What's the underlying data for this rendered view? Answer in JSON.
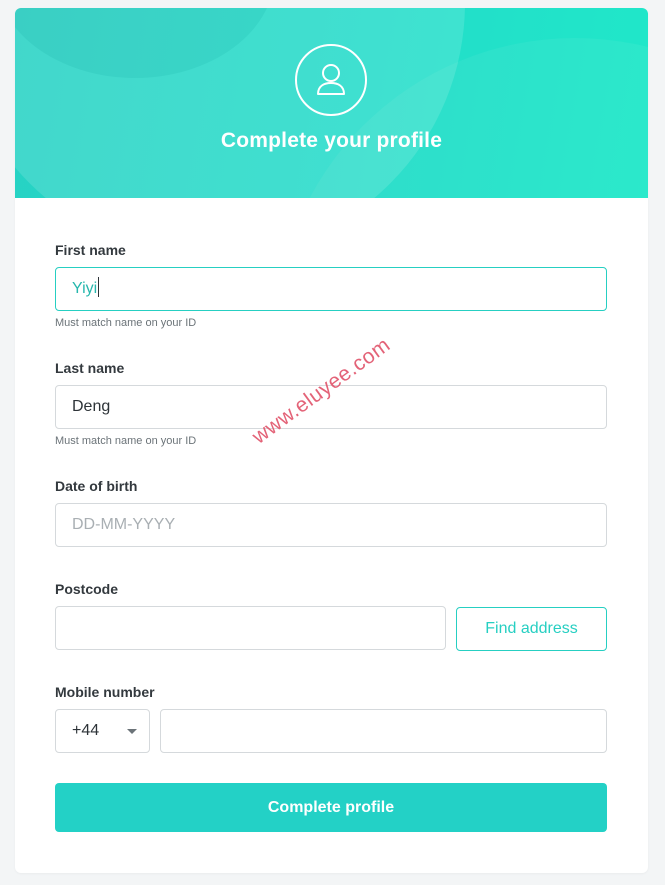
{
  "header": {
    "title": "Complete your profile",
    "icon": "user-icon"
  },
  "form": {
    "first_name": {
      "label": "First name",
      "value": "Yiyi",
      "help": "Must match name on your ID"
    },
    "last_name": {
      "label": "Last name",
      "value": "Deng",
      "help": "Must match name on your ID"
    },
    "dob": {
      "label": "Date of birth",
      "placeholder": "DD-MM-YYYY"
    },
    "postcode": {
      "label": "Postcode",
      "value": "",
      "find_button": "Find address"
    },
    "mobile": {
      "label": "Mobile number",
      "country_code": "+44",
      "value": ""
    },
    "submit": "Complete profile"
  },
  "watermark": "www.eluyee.com",
  "colors": {
    "accent": "#23d1c6",
    "watermark": "#e1536a"
  }
}
